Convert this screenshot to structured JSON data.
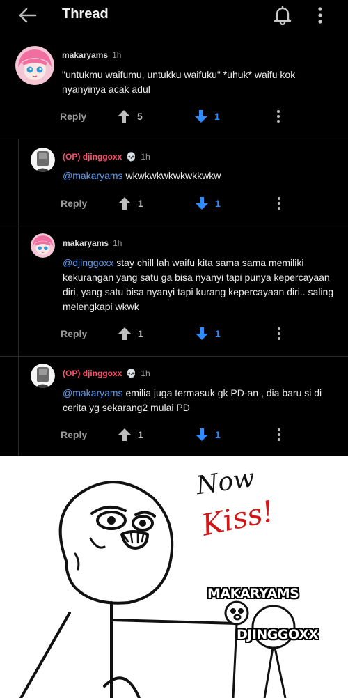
{
  "header": {
    "title": "Thread",
    "icons": [
      "back-arrow-icon",
      "bell-icon",
      "more-vertical-icon"
    ]
  },
  "comments": [
    {
      "author": "makaryams",
      "op_prefix": "",
      "time": "1h",
      "mention": "",
      "text": "\"untukmu waifumu, untukku waifuku\" *uhuk* waifu kok nyanyinya acak adul",
      "reply_label": "Reply",
      "upvotes": "5",
      "downvotes": "1"
    },
    {
      "author": "djinggoxx",
      "op_prefix": "(OP)",
      "flair": "💀",
      "time": "1h",
      "mention": "@makaryams",
      "text": "wkwkwkwkwkwkkwkw",
      "reply_label": "Reply",
      "upvotes": "1",
      "downvotes": "1"
    },
    {
      "author": "makaryams",
      "op_prefix": "",
      "time": "1h",
      "mention": "@djinggoxx",
      "text": "stay chill lah waifu kita sama sama memiliki kekurangan yang satu ga bisa nyanyi tapi punya kepercayaan diri, yang satu bisa nyanyi tapi kurang kepercayaan diri.. saling melengkapi wkwk",
      "reply_label": "Reply",
      "upvotes": "1",
      "downvotes": "1"
    },
    {
      "author": "djinggoxx",
      "op_prefix": "(OP)",
      "flair": "💀",
      "time": "1h",
      "mention": "@makaryams",
      "text": "emilia juga termasuk gk PD-an , dia baru si di cerita yg sekarang2 mulai PD",
      "reply_label": "Reply",
      "upvotes": "1",
      "downvotes": "1"
    }
  ],
  "meme": {
    "caption_now": "Now",
    "caption_kiss": "Kiss!",
    "label_1": "MAKARYAMS",
    "label_2": "DJINGGOXX"
  },
  "colors": {
    "background": "#000000",
    "op_red": "#ff4d6a",
    "mention_blue": "#5b9bf0",
    "downvote_blue": "#2f8cff"
  }
}
